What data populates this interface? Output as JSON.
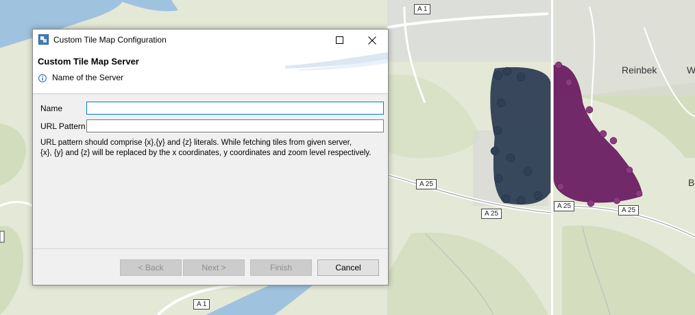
{
  "map": {
    "road_labels": [
      "A 1",
      "A 25",
      "A 25",
      "A 25",
      "A 25",
      "A 1"
    ],
    "place_labels": [
      "Reinbek",
      "W",
      "B"
    ],
    "cluster_colors": {
      "left": "#2f3f56",
      "right": "#6c1f64"
    }
  },
  "dialog": {
    "title": "Custom Tile Map Configuration",
    "icon": "app-config-icon",
    "page_title": "Custom Tile Map Server",
    "page_description": "Name of the Server",
    "fields": {
      "name_label": "Name",
      "name_value": "",
      "url_label": "URL Pattern",
      "url_value": ""
    },
    "help_line1": "URL pattern should comprise {x},{y} and {z} literals. While fetching tiles from given server,",
    "help_line2": "{x}, {y} and {z} will be replaced by the x coordinates, y coordinates and zoom level respectively.",
    "buttons": {
      "back": "< Back",
      "next": "Next >",
      "finish": "Finish",
      "cancel": "Cancel"
    }
  }
}
